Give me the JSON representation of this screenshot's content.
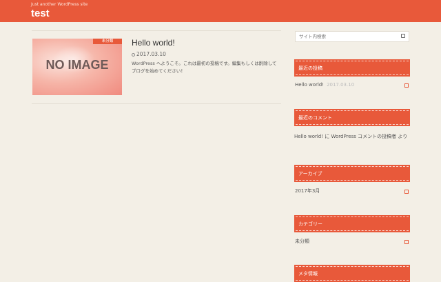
{
  "header": {
    "tagline": "Just another WordPress site",
    "title": "test",
    "color": "#e8593a"
  },
  "post": {
    "thumbnail_text": "NO IMAGE",
    "category": "未分類",
    "title": "Hello world!",
    "date": "2017.03.10",
    "excerpt": "WordPress へようこそ。これは最初の投稿です。編集もしくは削除してブログを始めてください！"
  },
  "sidebar": {
    "search_placeholder": "サイト内検索",
    "recent_posts": {
      "heading": "最近の投稿",
      "items": [
        {
          "title": "Hello world!",
          "date": "2017.03.10"
        }
      ]
    },
    "recent_comments": {
      "heading": "最近のコメント",
      "text": "Hello world! に WordPress コメントの投稿者 より"
    },
    "archives": {
      "heading": "アーカイブ",
      "items": [
        "2017年3月"
      ]
    },
    "categories": {
      "heading": "カテゴリー",
      "items": [
        "未分類"
      ]
    },
    "meta": {
      "heading": "メタ情報"
    }
  },
  "icons": {
    "date": "clock-icon",
    "search": "search-icon",
    "link": "link-icon"
  }
}
